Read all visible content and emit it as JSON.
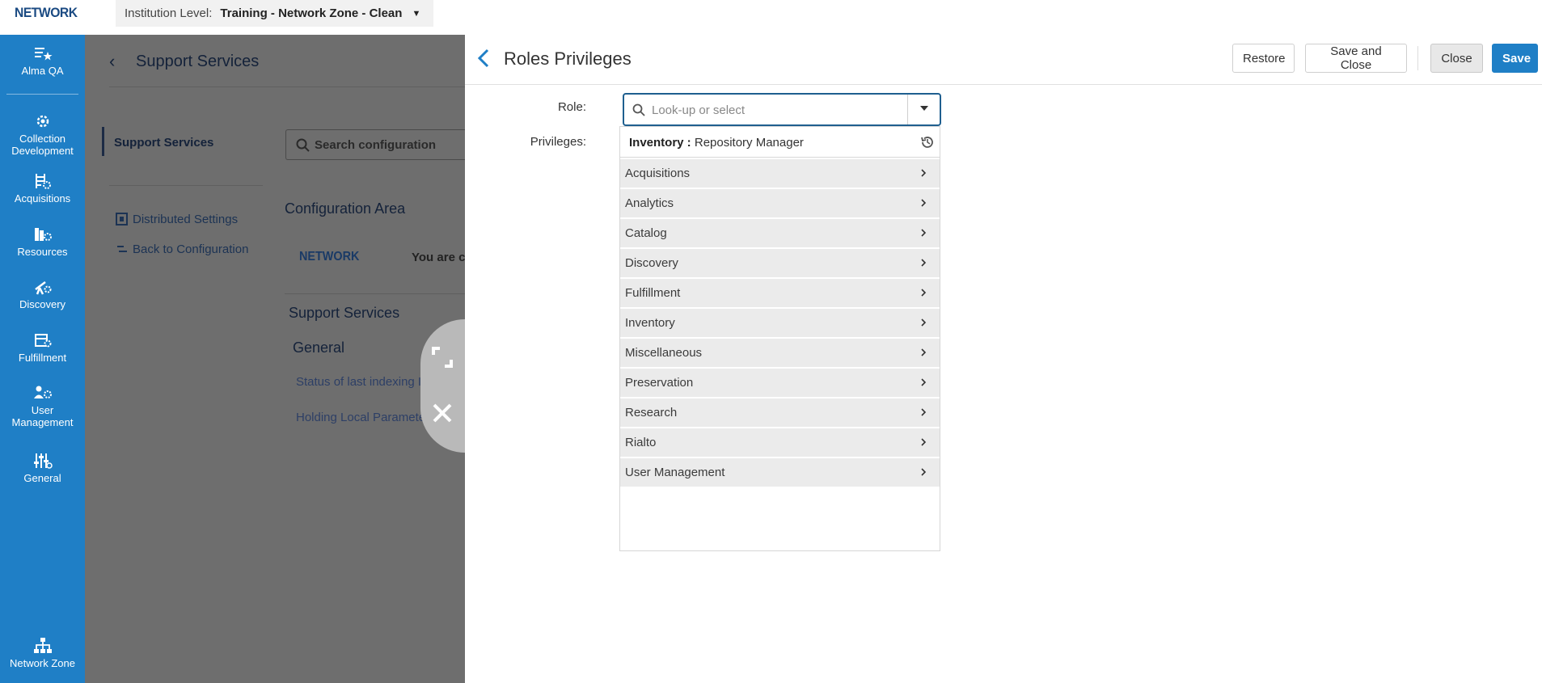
{
  "topbar": {
    "logo": "NETWORK",
    "institution_label": "Institution Level:",
    "institution_value": "Training - Network Zone - Clean",
    "caret": "▼"
  },
  "leftnav": {
    "items": [
      {
        "label": "Alma QA",
        "icon": "list-star-icon"
      },
      {
        "label": "Collection\nDevelopment",
        "icon": "gear-cluster-icon"
      },
      {
        "label": "Acquisitions",
        "icon": "ladder-gear-icon"
      },
      {
        "label": "Resources",
        "icon": "books-gear-icon"
      },
      {
        "label": "Discovery",
        "icon": "telescope-gear-icon"
      },
      {
        "label": "Fulfillment",
        "icon": "box-gear-icon"
      },
      {
        "label": "User\nManagement",
        "icon": "users-gear-icon"
      },
      {
        "label": "General",
        "icon": "sliders-icon"
      }
    ],
    "bottom": {
      "label": "Network Zone",
      "icon": "network-tree-icon"
    }
  },
  "background": {
    "title": "Support Services",
    "selected_item": "Support Services",
    "links": [
      "Distributed Settings",
      "Back to Configuration"
    ],
    "search_placeholder": "Search configuration",
    "area_title": "Configuration Area",
    "network_logo": "NETWORK",
    "you_are_text": "You are co",
    "section_title": "Support Services",
    "group_title": "General",
    "rows": [
      "Status of last indexing Indexing",
      "Holding Local Parameters for Holdings"
    ]
  },
  "panel": {
    "title": "Roles Privileges",
    "buttons": {
      "restore": "Restore",
      "save_and_close": "Save and Close",
      "close": "Close",
      "save": "Save"
    },
    "role_label": "Role:",
    "privileges_label": "Privileges:",
    "role_placeholder": "Look-up or select",
    "recent": {
      "bold": "Inventory :",
      "text": " Repository Manager"
    },
    "categories": [
      "Acquisitions",
      "Analytics",
      "Catalog",
      "Discovery",
      "Fulfillment",
      "Inventory",
      "Miscellaneous",
      "Preservation",
      "Research",
      "Rialto",
      "User Management"
    ]
  },
  "colors": {
    "nav_blue": "#1f7fc6",
    "primary_blue": "#1f7fc6",
    "dim_overlay": "#6e6e6e"
  }
}
